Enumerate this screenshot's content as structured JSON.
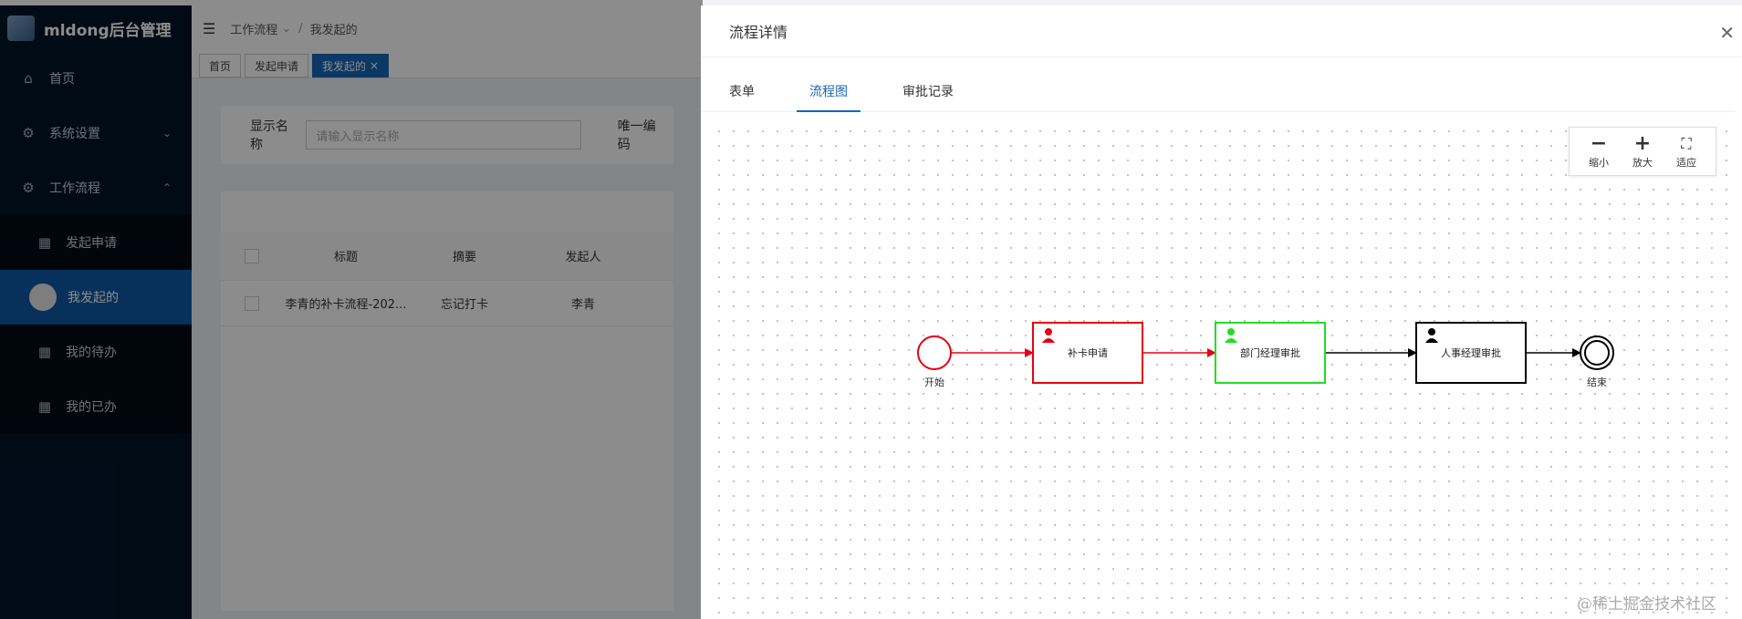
{
  "app": {
    "title": "mldong后台管理"
  },
  "sidebar": {
    "items": [
      {
        "label": "首页"
      },
      {
        "label": "系统设置"
      },
      {
        "label": "工作流程"
      }
    ],
    "sub_items": [
      {
        "label": "发起申请"
      },
      {
        "label": "我发起的"
      },
      {
        "label": "我的待办"
      },
      {
        "label": "我的已办"
      }
    ]
  },
  "header": {
    "breadcrumb": [
      "工作流程",
      "我发起的"
    ]
  },
  "tags": [
    "首页",
    "发起申请",
    "我发起的"
  ],
  "search": {
    "name_label": "显示名称",
    "name_placeholder": "请输入显示名称",
    "code_label": "唯一编码"
  },
  "table": {
    "columns": [
      "标题",
      "摘要",
      "发起人"
    ],
    "rows": [
      {
        "title": "李青的补卡流程-202...",
        "summary": "忘记打卡",
        "initiator": "李青"
      }
    ]
  },
  "drawer": {
    "title": "流程详情",
    "tabs": [
      "表单",
      "流程图",
      "审批记录"
    ],
    "active_tab": "流程图",
    "zoom": {
      "out": "缩小",
      "in": "放大",
      "fit": "适应"
    },
    "nodes": [
      {
        "label": "开始",
        "status": "done"
      },
      {
        "label": "补卡申请",
        "status": "done"
      },
      {
        "label": "部门经理审批",
        "status": "active"
      },
      {
        "label": "人事经理审批",
        "status": "pending"
      },
      {
        "label": "结束",
        "status": "pending"
      }
    ],
    "colors": {
      "done": "#e60012",
      "active": "#22dd22",
      "pending": "#000000",
      "accent": "#1766b8"
    }
  },
  "watermark": "@稀土掘金技术社区"
}
